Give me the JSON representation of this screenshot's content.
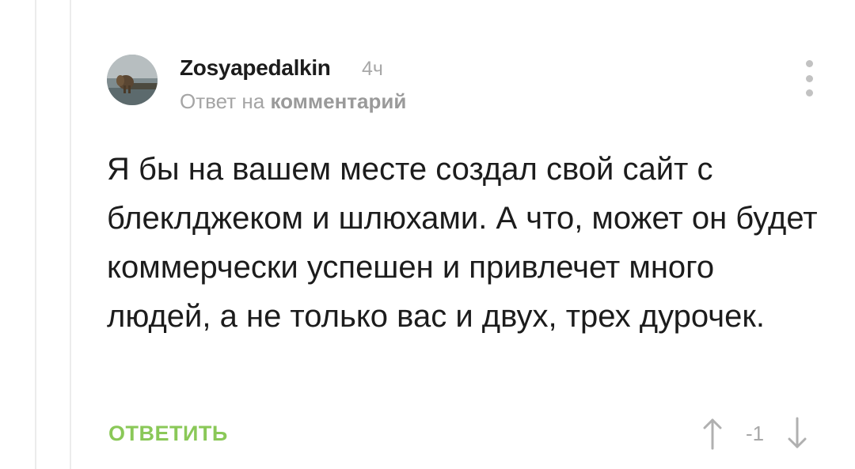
{
  "comment": {
    "author": "Zosyapedalkin",
    "time": "4ч",
    "reply_prefix": "Ответ на",
    "reply_link": "комментарий",
    "text": "Я бы на вашем месте создал свой сайт с блеклджеком и шлюхами. А что, может он будет коммерчески успешен и привлечет много людей, а не только вас и двух, трех дурочек.",
    "reply_button": "ОТВЕТИТЬ",
    "rating": "-1",
    "icons": {
      "more": "more-vertical-icon",
      "upvote": "arrow-up-icon",
      "downvote": "arrow-down-icon"
    }
  },
  "colors": {
    "accent_green": "#8ac858",
    "muted_text": "#a8a8a8",
    "main_text": "#1c1c1c"
  }
}
